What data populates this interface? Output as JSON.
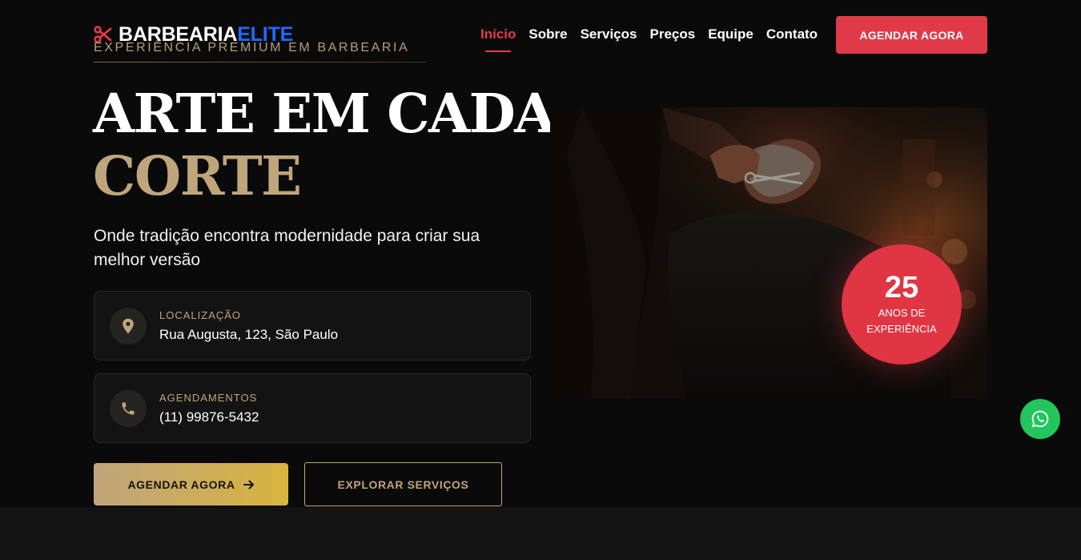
{
  "brand": {
    "name_main": "BARBEARIA",
    "name_accent": "ELITE",
    "tagline": "EXPERIÊNCIA PREMIUM EM BARBEARIA",
    "logo_icon": "scissors-icon"
  },
  "nav": {
    "items": [
      {
        "label": "Início",
        "active": true
      },
      {
        "label": "Sobre",
        "active": false
      },
      {
        "label": "Serviços",
        "active": false
      },
      {
        "label": "Preços",
        "active": false
      },
      {
        "label": "Equipe",
        "active": false
      },
      {
        "label": "Contato",
        "active": false
      }
    ],
    "cta_label": "AGENDAR AGORA"
  },
  "hero": {
    "title_line1": "ARTE EM CADA",
    "title_line2": "CORTE",
    "subtitle": "Onde tradição encontra modernidade para criar sua melhor versão",
    "cards": {
      "location": {
        "label": "LOCALIZAÇÃO",
        "value": "Rua Augusta, 123, São Paulo",
        "icon": "location-pin-icon"
      },
      "booking": {
        "label": "AGENDAMENTOS",
        "value": "(11) 99876-5432",
        "icon": "phone-icon"
      }
    },
    "primary_button": "AGENDAR AGORA",
    "secondary_button": "EXPLORAR SERVIÇOS"
  },
  "badge": {
    "number": "25",
    "line1": "ANOS DE",
    "line2": "EXPERIÊNCIA"
  },
  "colors": {
    "accent_red": "#e03a48",
    "gold": "#bfa57c",
    "brand_blue": "#1f6bff",
    "whatsapp_green": "#23c65d",
    "background": "#0b0a0a"
  },
  "floating": {
    "whatsapp_icon": "whatsapp-icon"
  }
}
